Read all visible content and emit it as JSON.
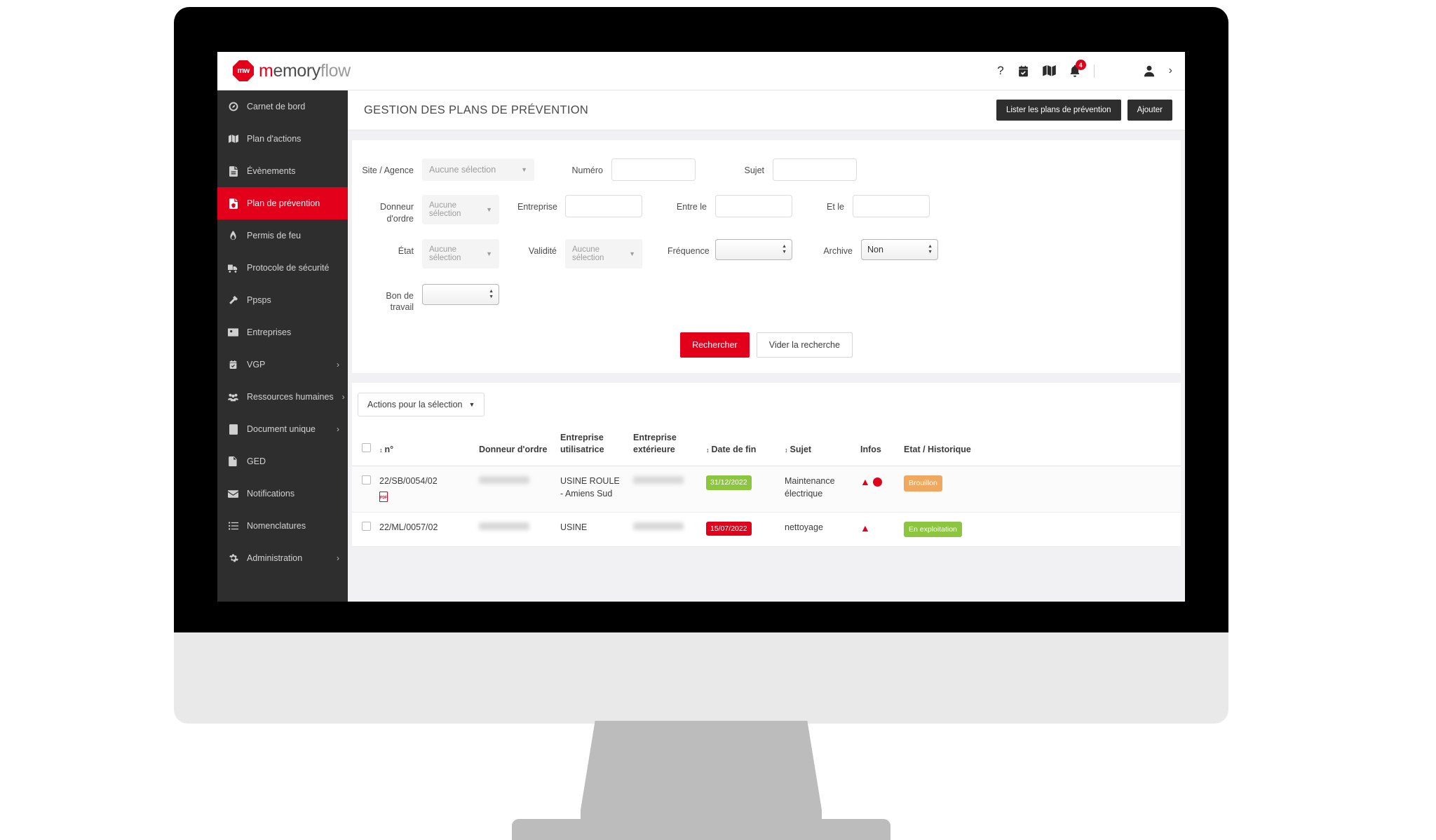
{
  "brand": {
    "mark_text": "mw",
    "name_part1_accent": "m",
    "name_part1": "emory",
    "name_part2": "flow",
    "accent_color": "#e2001a"
  },
  "topbar": {
    "icons": [
      {
        "name": "help-icon",
        "glyph": "?"
      },
      {
        "name": "calendar-check-icon",
        "glyph": "Ὄ5"
      },
      {
        "name": "map-icon",
        "glyph": "map"
      },
      {
        "name": "bell-icon",
        "glyph": "bell",
        "badge": "4"
      }
    ],
    "user_icon": "user-icon",
    "chevron": "›"
  },
  "sidebar": {
    "items": [
      {
        "label": "Carnet de bord",
        "icon": "dashboard-icon",
        "active": false,
        "arrow": false
      },
      {
        "label": "Plan d'actions",
        "icon": "map-icon",
        "active": false,
        "arrow": false
      },
      {
        "label": "Évènements",
        "icon": "file-icon",
        "active": false,
        "arrow": false
      },
      {
        "label": "Plan de prévention",
        "icon": "file-shield-icon",
        "active": true,
        "arrow": false
      },
      {
        "label": "Permis de feu",
        "icon": "flame-icon",
        "active": false,
        "arrow": false
      },
      {
        "label": "Protocole de sécurité",
        "icon": "truck-icon",
        "active": false,
        "arrow": false
      },
      {
        "label": "Ppsps",
        "icon": "hammer-icon",
        "active": false,
        "arrow": false
      },
      {
        "label": "Entreprises",
        "icon": "id-card-icon",
        "active": false,
        "arrow": false
      },
      {
        "label": "VGP",
        "icon": "calendar-check-icon",
        "active": false,
        "arrow": true
      },
      {
        "label": "Ressources humaines",
        "icon": "users-icon",
        "active": false,
        "arrow": true
      },
      {
        "label": "Document unique",
        "icon": "book-icon",
        "active": false,
        "arrow": true
      },
      {
        "label": "GED",
        "icon": "folder-icon",
        "active": false,
        "arrow": false
      },
      {
        "label": "Notifications",
        "icon": "envelope-icon",
        "active": false,
        "arrow": false
      },
      {
        "label": "Nomenclatures",
        "icon": "list-icon",
        "active": false,
        "arrow": false
      },
      {
        "label": "Administration",
        "icon": "gear-icon",
        "active": false,
        "arrow": true
      }
    ]
  },
  "page": {
    "title": "GESTION DES PLANS DE PRÉVENTION",
    "btn_list": "Lister les plans de prévention",
    "btn_add": "Ajouter"
  },
  "search": {
    "site_label": "Site / Agence",
    "site_value": "Aucune sélection",
    "numero_label": "Numéro",
    "numero_value": "",
    "sujet_label": "Sujet",
    "sujet_value": "",
    "donneur_label": "Donneur d'ordre",
    "donneur_value": "Aucune sélection",
    "entreprise_label": "Entreprise",
    "entreprise_value": "",
    "entre_le_label": "Entre le",
    "entre_le_value": "",
    "et_le_label": "Et le",
    "et_le_value": "",
    "etat_label": "État",
    "etat_value": "Aucune sélection",
    "validite_label": "Validité",
    "validite_value": "Aucune sélection",
    "frequence_label": "Fréquence",
    "frequence_value": "",
    "archive_label": "Archive",
    "archive_value": "Non",
    "bon_label": "Bon de travail",
    "bon_value": "",
    "btn_search": "Rechercher",
    "btn_clear": "Vider la recherche"
  },
  "results": {
    "bulk_label": "Actions pour la sélection",
    "columns": [
      {
        "label": "",
        "sortable": false
      },
      {
        "label": "n°",
        "sortable": true
      },
      {
        "label": "Donneur d'ordre",
        "sortable": false
      },
      {
        "label": "Entreprise utilisatrice",
        "sortable": false
      },
      {
        "label": "Entreprise extérieure",
        "sortable": false
      },
      {
        "label": "Date de fin",
        "sortable": true
      },
      {
        "label": "Sujet",
        "sortable": true
      },
      {
        "label": "Infos",
        "sortable": false
      },
      {
        "label": "Etat / Historique",
        "sortable": false
      }
    ],
    "rows": [
      {
        "numero": "22/SB/0054/02",
        "has_pdf": true,
        "donneur": "",
        "donneur_blurred": true,
        "ent_utilisatrice": "USINE ROULE - Amiens Sud",
        "ent_exterieure": "",
        "ext_blurred": true,
        "date_fin": "31/12/2022",
        "date_color": "#8cc63e",
        "sujet": "Maintenance électrique",
        "has_warning": true,
        "has_clock": true,
        "etat": "Brouillon",
        "etat_color": "#f0a860"
      },
      {
        "numero": "22/ML/0057/02",
        "has_pdf": false,
        "donneur": "",
        "donneur_blurred": true,
        "ent_utilisatrice": "USINE",
        "ent_exterieure": "",
        "ext_blurred": true,
        "date_fin": "15/07/2022",
        "date_color": "#e2001a",
        "sujet": "nettoyage",
        "has_warning": true,
        "has_clock": false,
        "etat": "En exploitation",
        "etat_color": "#8cc63e"
      }
    ]
  }
}
